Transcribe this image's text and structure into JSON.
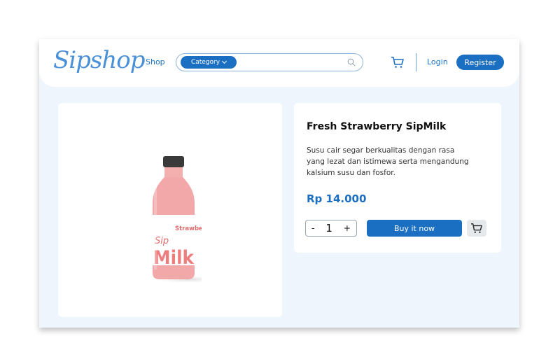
{
  "header": {
    "logo": "Sipshop",
    "nav_shop": "Shop",
    "category_label": "Category",
    "login_label": "Login",
    "register_label": "Register"
  },
  "product": {
    "title": "Fresh Strawberry SipMilk",
    "description": "Susu cair segar berkualitas dengan rasa yang lezat dan istimewa serta mengandung kalsium susu dan fosfor.",
    "price": "Rp 14.000",
    "quantity": "1",
    "qty_minus": "-",
    "qty_plus": "+",
    "buy_label": "Buy it now"
  },
  "bottle_label": {
    "flavor": "Strawberry",
    "brand_script": "Sip",
    "brand": "Milk"
  },
  "colors": {
    "accent": "#1a6fc2",
    "logo": "#4a90d9",
    "background": "#eef5fc",
    "bottle_pink": "#f2a8a8"
  },
  "icons": {
    "search": "search-icon",
    "cart": "cart-icon",
    "chevron": "chevron-down-icon"
  }
}
